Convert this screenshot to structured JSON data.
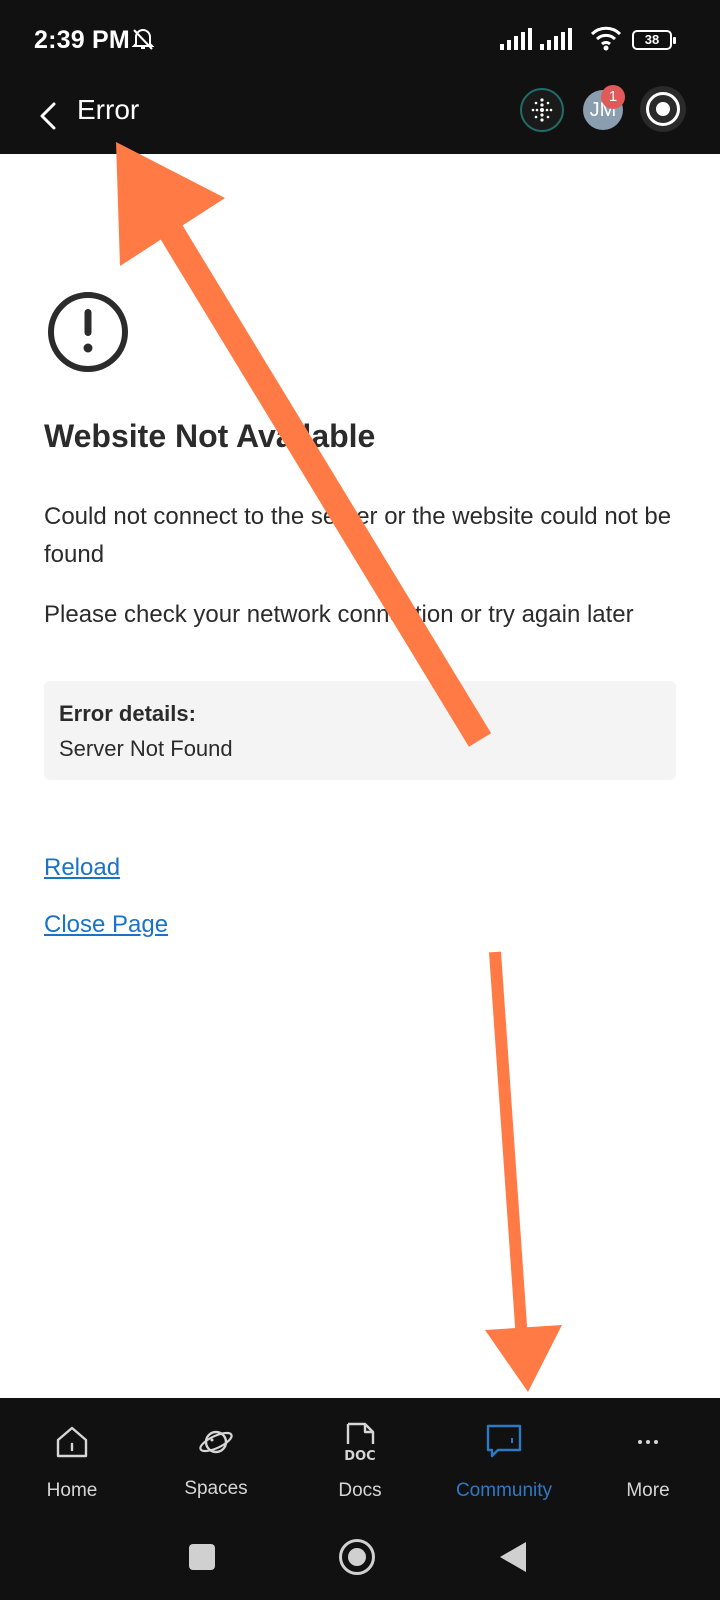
{
  "status_bar": {
    "time": "2:39 PM",
    "battery": "38"
  },
  "header": {
    "title": "Error",
    "avatar_initials": "JM",
    "notification_count": "1"
  },
  "error": {
    "heading": "Website Not Available",
    "message_1": "Could not connect to the server or the website could not be found",
    "message_2": "Please check your network connection or try again later",
    "details_label": "Error details:",
    "details_value": "Server Not Found"
  },
  "links": {
    "reload": "Reload",
    "close_page": "Close Page"
  },
  "bottom_nav": {
    "items": [
      {
        "label": "Home",
        "icon": "home-icon"
      },
      {
        "label": "Spaces",
        "icon": "planet-icon"
      },
      {
        "label": "Docs",
        "icon": "doc-icon"
      },
      {
        "label": "Community",
        "icon": "chat-icon",
        "active": true
      },
      {
        "label": "More",
        "icon": "more-icon"
      }
    ]
  },
  "colors": {
    "accent": "#1a73c8",
    "active_nav": "#2f79c4",
    "annotation_arrow": "#ff7a45",
    "bar": "#111111"
  }
}
